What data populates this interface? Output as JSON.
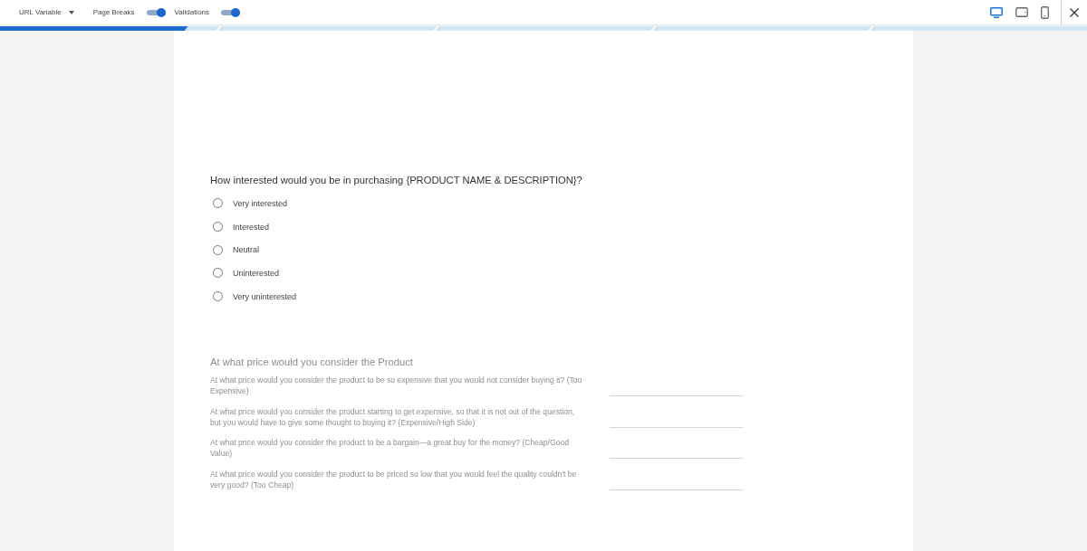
{
  "toolbar": {
    "url_variable": {
      "label": "URL Variable"
    },
    "toggles": [
      {
        "label": "Page Breaks",
        "on": true
      },
      {
        "label": "Validations",
        "on": true
      }
    ],
    "devices": [
      {
        "kind": "desktop",
        "selected": true
      },
      {
        "kind": "tablet",
        "selected": false
      },
      {
        "kind": "phone",
        "selected": false
      }
    ]
  },
  "progress": {
    "level": 0.173
  },
  "questions": [
    {
      "kind": "single_choice",
      "disabled": false,
      "title": "How interested would you be in purchasing {PRODUCT NAME & DESCRIPTION}?",
      "options": [
        {
          "label": "Very interested",
          "selected": false
        },
        {
          "label": "Interested",
          "selected": false
        },
        {
          "label": "Neutral",
          "selected": false
        },
        {
          "label": "Uninterested",
          "selected": false
        },
        {
          "label": "Very uninterested",
          "selected": false
        }
      ]
    },
    {
      "kind": "price_grid",
      "disabled": true,
      "title": "At what price would you consider the Product",
      "items": [
        {
          "label": "At what price would you consider the product to be so expensive that you would not consider buying it? (Too Expensive)"
        },
        {
          "label": "At what price would you consider the product starting to get expensive, so that it is not out of the question, but you would have to give some thought to buying it? (Expensive/High Side)"
        },
        {
          "label": "At what price would you consider the product to be a bargain—a great buy for the money? (Cheap/Good Value)"
        },
        {
          "label": "At what price would you consider the product to be priced so low that you would feel the quality couldn't be very good? (Too Cheap)"
        }
      ]
    }
  ]
}
